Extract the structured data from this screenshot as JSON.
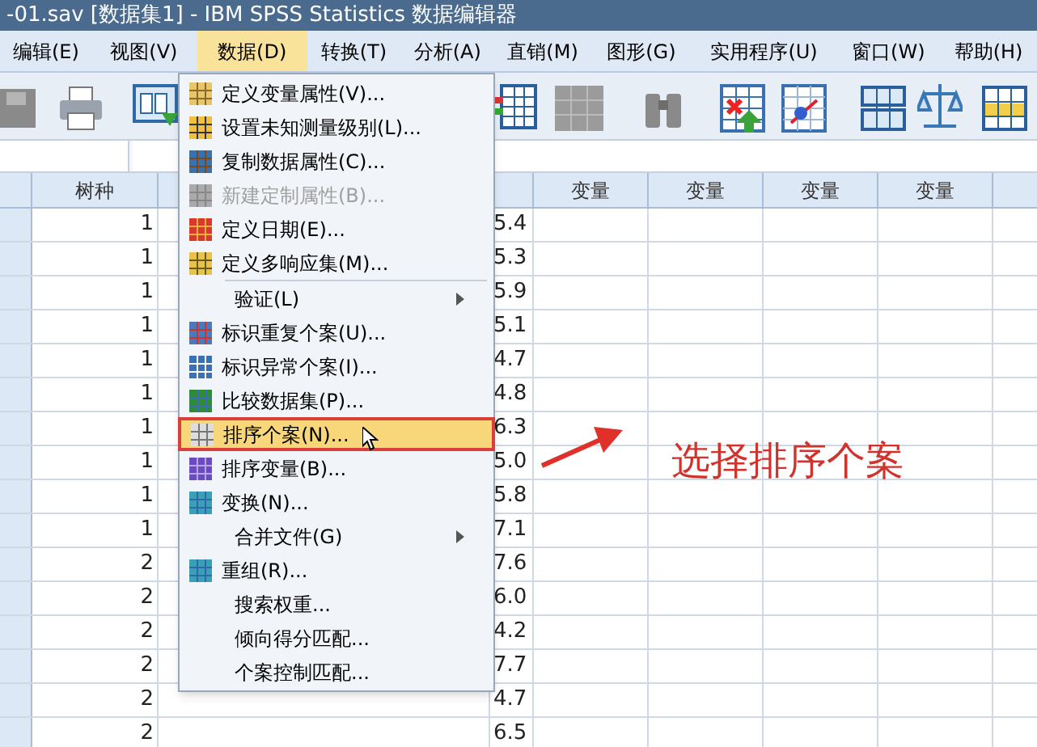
{
  "window": {
    "title": "-01.sav [数据集1] - IBM SPSS Statistics 数据编辑器"
  },
  "menu_bar": [
    {
      "label": "编辑(E)",
      "selected": false
    },
    {
      "label": "视图(V)",
      "selected": false
    },
    {
      "label": "数据(D)",
      "selected": true
    },
    {
      "label": "转换(T)",
      "selected": false
    },
    {
      "label": "分析(A)",
      "selected": false
    },
    {
      "label": "直销(M)",
      "selected": false
    },
    {
      "label": "图形(G)",
      "selected": false
    },
    {
      "label": "实用程序(U)",
      "selected": false
    },
    {
      "label": "窗口(W)",
      "selected": false
    },
    {
      "label": "帮助(H)",
      "selected": false
    }
  ],
  "grid": {
    "first_column_header": "树种",
    "variable_headers": [
      "变量",
      "变量",
      "变量",
      "变量"
    ],
    "rows": [
      [
        "1",
        "5.4"
      ],
      [
        "1",
        "5.3"
      ],
      [
        "1",
        "5.9"
      ],
      [
        "1",
        "5.1"
      ],
      [
        "1",
        "4.7"
      ],
      [
        "1",
        "4.8"
      ],
      [
        "1",
        "6.3"
      ],
      [
        "1",
        "5.0"
      ],
      [
        "1",
        "5.8"
      ],
      [
        "1",
        "7.1"
      ],
      [
        "2",
        "7.6"
      ],
      [
        "2",
        "6.0"
      ],
      [
        "2",
        "4.2"
      ],
      [
        "2",
        "7.7"
      ],
      [
        "2",
        "4.7"
      ],
      [
        "2",
        "6.5"
      ]
    ]
  },
  "data_menu": [
    {
      "kind": "item",
      "label": "定义变量属性(V)...",
      "disabled": false,
      "selected": false,
      "submenu": false
    },
    {
      "kind": "item",
      "label": "设置未知测量级别(L)...",
      "disabled": false,
      "selected": false,
      "submenu": false
    },
    {
      "kind": "item",
      "label": "复制数据属性(C)...",
      "disabled": false,
      "selected": false,
      "submenu": false
    },
    {
      "kind": "item",
      "label": "新建定制属性(B)...",
      "disabled": true,
      "selected": false,
      "submenu": false
    },
    {
      "kind": "item",
      "label": "定义日期(E)...",
      "disabled": false,
      "selected": false,
      "submenu": false
    },
    {
      "kind": "item",
      "label": "定义多响应集(M)...",
      "disabled": false,
      "selected": false,
      "submenu": false
    },
    {
      "kind": "separator"
    },
    {
      "kind": "item",
      "label": "验证(L)",
      "disabled": false,
      "selected": false,
      "submenu": true
    },
    {
      "kind": "item",
      "label": "标识重复个案(U)...",
      "disabled": false,
      "selected": false,
      "submenu": false
    },
    {
      "kind": "item",
      "label": "标识异常个案(I)...",
      "disabled": false,
      "selected": false,
      "submenu": false
    },
    {
      "kind": "item",
      "label": "比较数据集(P)...",
      "disabled": false,
      "selected": false,
      "submenu": false
    },
    {
      "kind": "item",
      "label": "排序个案(N)...",
      "disabled": false,
      "selected": true,
      "submenu": false
    },
    {
      "kind": "item",
      "label": "排序变量(B)...",
      "disabled": false,
      "selected": false,
      "submenu": false
    },
    {
      "kind": "item",
      "label": "变换(N)...",
      "disabled": false,
      "selected": false,
      "submenu": false
    },
    {
      "kind": "item",
      "label": "合并文件(G)",
      "disabled": false,
      "selected": false,
      "submenu": true
    },
    {
      "kind": "item",
      "label": "重组(R)...",
      "disabled": false,
      "selected": false,
      "submenu": false
    },
    {
      "kind": "item",
      "label": "搜索权重...",
      "disabled": false,
      "selected": false,
      "submenu": false
    },
    {
      "kind": "item",
      "label": "倾向得分匹配...",
      "disabled": false,
      "selected": false,
      "submenu": false
    },
    {
      "kind": "item",
      "label": "个案控制匹配...",
      "disabled": false,
      "selected": false,
      "submenu": false
    }
  ],
  "annotation": {
    "label": "选择排序个案"
  }
}
